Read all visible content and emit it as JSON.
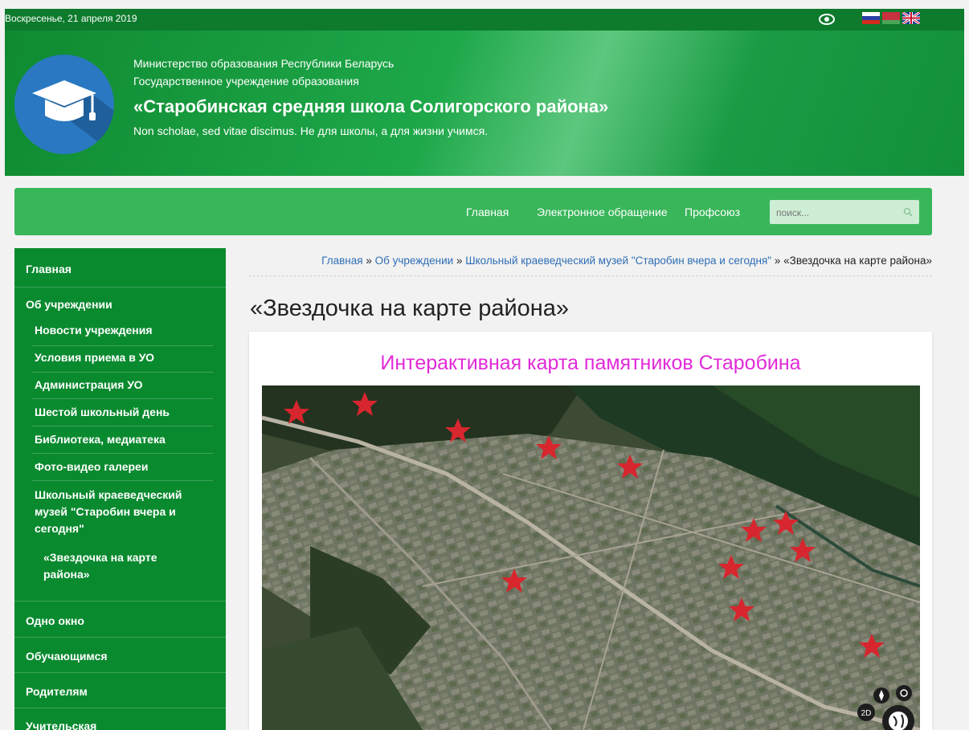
{
  "top_bar": {
    "date": "Воскресенье, 21 апреля 2019",
    "background": "#0d7a2c",
    "icons": [
      "eye-icon",
      "flag-ru-icon",
      "flag-by-icon",
      "flag-uk-icon"
    ]
  },
  "header": {
    "line1": "Министерство образования Республики Беларусь",
    "line2": "Государственное учреждение образования",
    "school_name": "«Старобинская средняя школа Солигорского района»",
    "motto": "Non scholae, sed vitae discimus. Не для школы, а для жизни учимся.",
    "accent": "#12903a"
  },
  "nav": {
    "items": [
      "Главная",
      "Электронное обращение",
      "Профсоюз"
    ],
    "search_placeholder": "поиск..."
  },
  "sidebar": {
    "items": [
      {
        "label": "Главная"
      },
      {
        "label": "Об учреждении"
      },
      {
        "label": "Одно окно"
      },
      {
        "label": "Обучающимся"
      },
      {
        "label": "Родителям"
      },
      {
        "label": "Учительская"
      }
    ],
    "subitems": [
      "Новости учреждения",
      "Условия приема в УО",
      "Администрация УО",
      "Шестой школьный день",
      "Библиотека, медиатека",
      "Фото-видео галереи",
      "Школьный краеведческий музей \"Старобин вчера и сегодня\"",
      "«Звездочка на карте района»"
    ]
  },
  "breadcrumb": {
    "items": [
      "Главная",
      "Об учреждении",
      "Школьный краеведческий музей \"Старобин вчера и сегодня\""
    ],
    "current": "«Звездочка на карте района»",
    "separator": "»"
  },
  "page": {
    "title": "«Звездочка на карте района»",
    "map_title": "Интерактивная карта памятников Старобина",
    "map_title_color": "#e02ad7",
    "map_controls": [
      "compass-icon",
      "location-icon",
      "2D",
      "globe-icon"
    ]
  }
}
